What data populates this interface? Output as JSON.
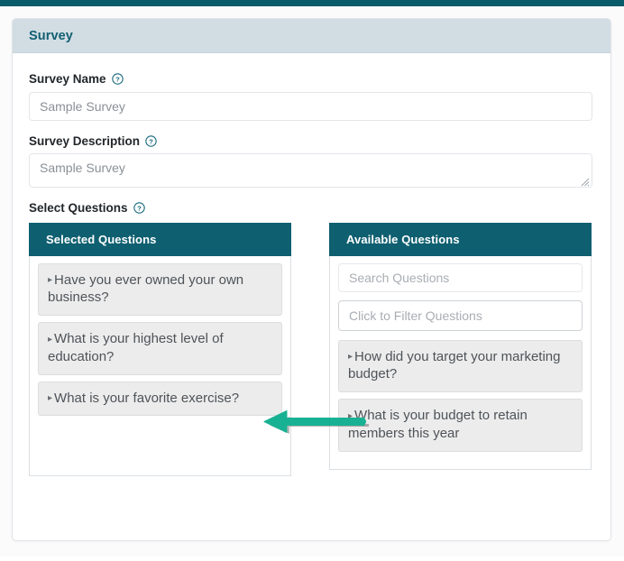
{
  "card": {
    "title": "Survey",
    "header_bg": "#d2dde3",
    "title_color": "#115e72"
  },
  "topbar": {
    "color": "#0b5c6b"
  },
  "fields": {
    "survey_name": {
      "label": "Survey Name",
      "help_icon": "help-circle-icon",
      "value": "Sample Survey",
      "placeholder": "Sample Survey"
    },
    "survey_description": {
      "label": "Survey Description",
      "help_icon": "help-circle-icon",
      "value": "Sample Survey",
      "placeholder": "Sample Survey"
    },
    "select_questions": {
      "label": "Select Questions",
      "help_icon": "help-circle-icon"
    }
  },
  "selected_panel": {
    "header": "Selected Questions",
    "header_bg": "#0e5f70",
    "items": [
      {
        "caret": "▸",
        "text": "Have you ever owned your own business?"
      },
      {
        "caret": "▸",
        "text": "What is your highest level of education?"
      },
      {
        "caret": "▸",
        "text": "What is your favorite exercise?"
      }
    ]
  },
  "available_panel": {
    "header": "Available Questions",
    "header_bg": "#0e5f70",
    "search_placeholder": "Search Questions",
    "filter_placeholder": "Click to Filter Questions",
    "items": [
      {
        "caret": "▸",
        "text": "How did you target your marketing budget?"
      },
      {
        "caret": "▸",
        "text": "What is your budget to retain members this year"
      }
    ]
  },
  "annotation": {
    "arrow": {
      "name": "move-left-arrow",
      "color": "#19b193",
      "direction": "left"
    }
  }
}
